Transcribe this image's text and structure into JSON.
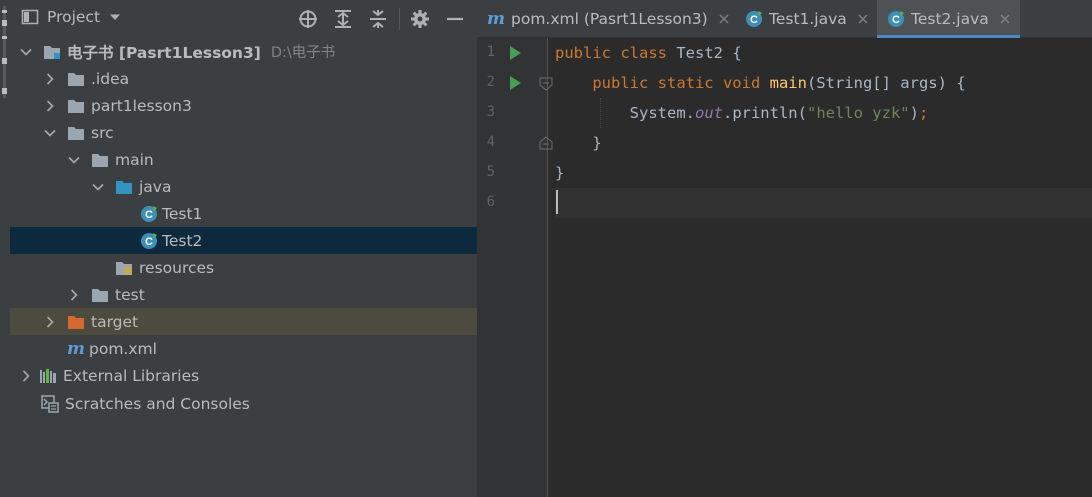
{
  "project_panel": {
    "title": "Project",
    "tree": [
      {
        "label": "电子书 [Pasrt1Lesson3]",
        "path": "D:\\电子书",
        "icon": "module-folder-icon",
        "expanded": true
      },
      {
        "label": ".idea",
        "icon": "folder-icon",
        "expanded": false
      },
      {
        "label": "part1lesson3",
        "icon": "folder-icon",
        "expanded": false
      },
      {
        "label": "src",
        "icon": "folder-icon",
        "expanded": true
      },
      {
        "label": "main",
        "icon": "folder-icon",
        "expanded": true
      },
      {
        "label": "java",
        "icon": "source-folder-icon",
        "expanded": true
      },
      {
        "label": "Test1",
        "icon": "java-class-icon"
      },
      {
        "label": "Test2",
        "icon": "java-class-icon",
        "selected": true
      },
      {
        "label": "resources",
        "icon": "resources-folder-icon"
      },
      {
        "label": "test",
        "icon": "folder-icon",
        "expanded": false
      },
      {
        "label": "target",
        "icon": "excluded-folder-icon",
        "expanded": false
      },
      {
        "label": "pom.xml",
        "icon": "maven-icon"
      },
      {
        "label": "External Libraries",
        "icon": "libraries-icon",
        "expanded": false
      },
      {
        "label": "Scratches and Consoles",
        "icon": "scratches-icon"
      }
    ]
  },
  "tabs": [
    {
      "label": "pom.xml (Pasrt1Lesson3)",
      "icon": "maven-icon",
      "active": false
    },
    {
      "label": "Test1.java",
      "icon": "java-class-icon",
      "active": false
    },
    {
      "label": "Test2.java",
      "icon": "java-class-icon",
      "active": true
    }
  ],
  "editor": {
    "line_numbers": [
      "1",
      "2",
      "3",
      "4",
      "5",
      "6"
    ],
    "current_line": 6,
    "lines": [
      {
        "indent": "",
        "tokens": [
          {
            "t": "public class ",
            "c": "kw"
          },
          {
            "t": "Test2 {",
            "c": ""
          }
        ]
      },
      {
        "indent": "    ",
        "tokens": [
          {
            "t": "public static void ",
            "c": "kw"
          },
          {
            "t": "main",
            "c": "fn"
          },
          {
            "t": "(String[] args) {",
            "c": ""
          }
        ]
      },
      {
        "indent": "        ",
        "tokens": [
          {
            "t": "System.",
            "c": ""
          },
          {
            "t": "out",
            "c": "fld"
          },
          {
            "t": ".println(",
            "c": ""
          },
          {
            "t": "\"hello yzk\"",
            "c": "str"
          },
          {
            "t": ")",
            "c": ""
          },
          {
            "t": ";",
            "c": "kw"
          }
        ]
      },
      {
        "indent": "    ",
        "tokens": [
          {
            "t": "}",
            "c": ""
          }
        ]
      },
      {
        "indent": "",
        "tokens": [
          {
            "t": "}",
            "c": ""
          }
        ]
      },
      {
        "indent": "",
        "tokens": []
      }
    ]
  },
  "colors": {
    "selection": "#0d293e",
    "excluded": "#4d4b40",
    "accent": "#4a88c7",
    "run": "#499c54"
  }
}
